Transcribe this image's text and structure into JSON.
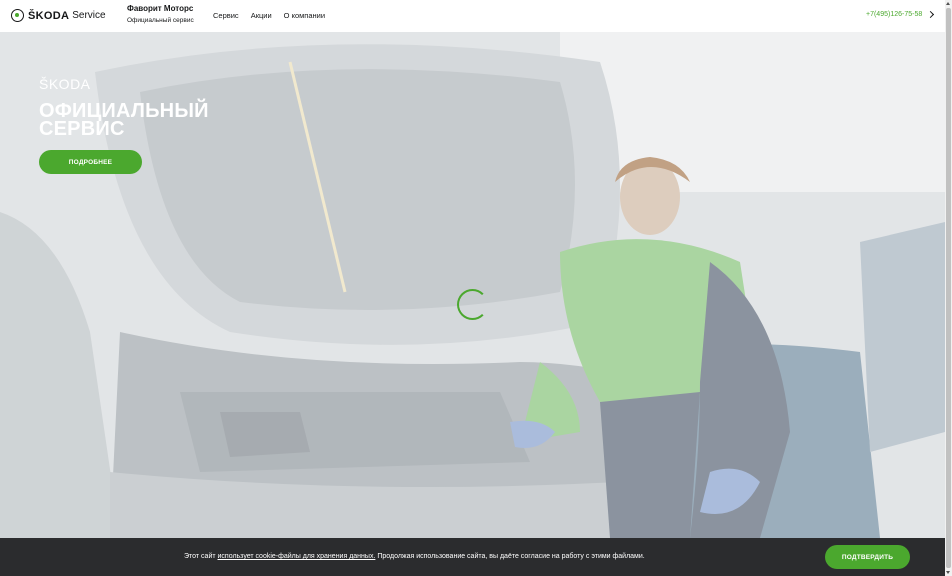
{
  "header": {
    "brand_word": "ŠKODA",
    "brand_service": "Service",
    "dealer_name": "Фаворит Моторс",
    "dealer_sub": "Официальный сервис",
    "nav": [
      "Сервис",
      "Акции",
      "О компании"
    ],
    "phone": "+7(495)126-75-58"
  },
  "hero": {
    "logo": "ŠKODA",
    "title": "ОФИЦИАЛЬНЫЙ СЕРВИС",
    "button": "ПОДРОБНЕЕ"
  },
  "cookie": {
    "text_before": "Этот сайт ",
    "link": "использует cookie-файлы для хранения данных.",
    "text_after": " Продолжая использование сайта, вы даёте согласие на работу с этими файлами.",
    "button": "ПОДТВЕРДИТЬ"
  },
  "colors": {
    "accent": "#4ba82e",
    "cookie_bg": "#2b2c2e",
    "text": "#161718"
  }
}
